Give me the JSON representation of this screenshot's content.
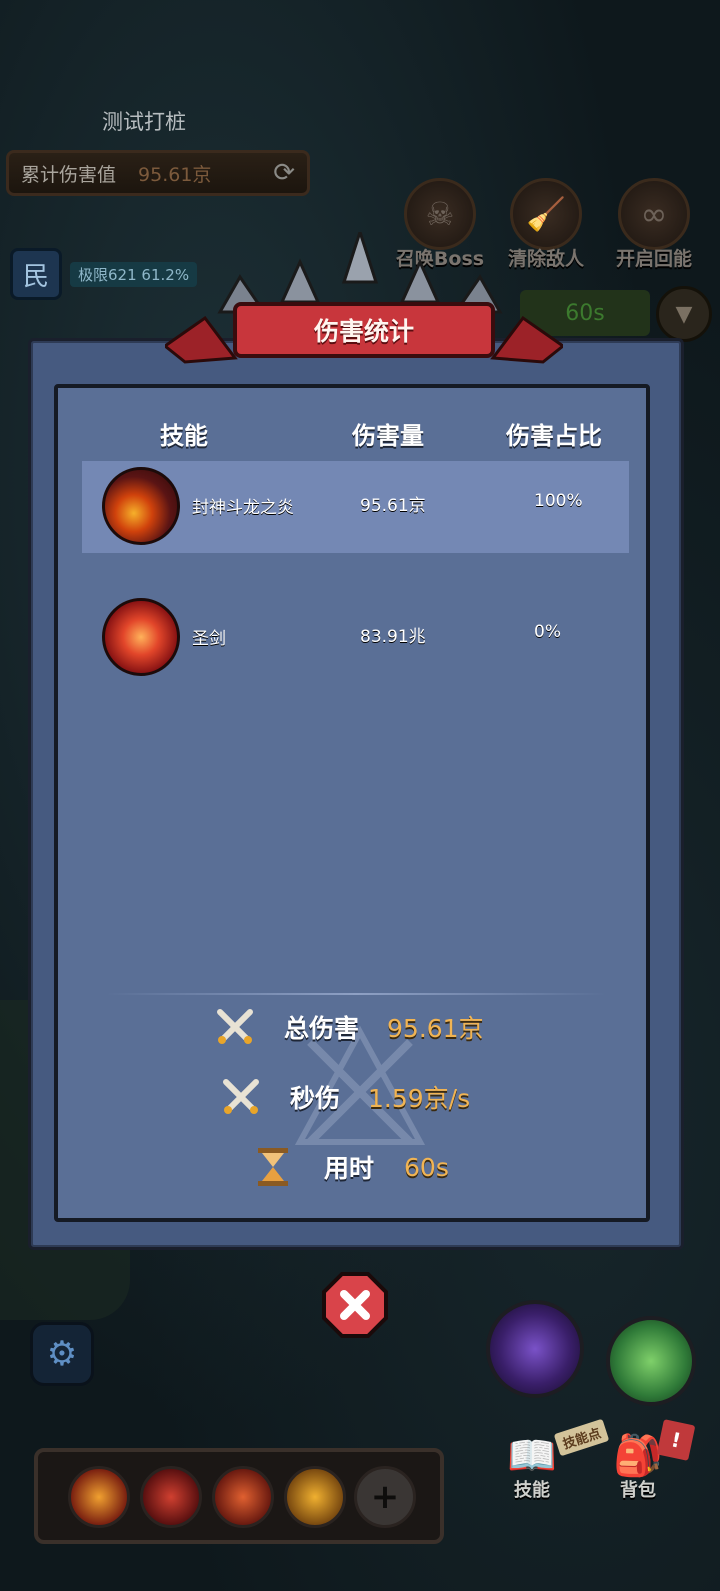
{
  "background": {
    "title": "测试打桩",
    "cumulative_damage": {
      "label": "累计伤害值",
      "value": "95.61京"
    },
    "limit": {
      "text": "极限621",
      "percent": "61.2%"
    },
    "top_buttons": [
      {
        "label": "召唤Boss",
        "icon": "skull-icon"
      },
      {
        "label": "清除敌人",
        "icon": "broom-icon"
      },
      {
        "label": "开启回能",
        "icon": "infinity-icon"
      }
    ],
    "timer": "60s"
  },
  "modal": {
    "title": "伤害统计",
    "columns": {
      "skill": "技能",
      "damage": "伤害量",
      "share": "伤害占比"
    },
    "rows": [
      {
        "name": "封神斗龙之炎",
        "damage": "95.61京",
        "share": "100%",
        "icon": "dragon-flame-icon",
        "selected": true
      },
      {
        "name": "圣剑",
        "damage": "83.91兆",
        "share": "0%",
        "icon": "holy-sword-icon",
        "selected": false
      }
    ],
    "summary": {
      "total": {
        "label": "总伤害",
        "value": "95.61京",
        "icon": "crossed-swords-icon"
      },
      "dps": {
        "label": "秒伤",
        "value": "1.59京/s",
        "icon": "crossed-swords-icon"
      },
      "time": {
        "label": "用时",
        "value": "60s",
        "icon": "hourglass-icon"
      }
    }
  },
  "bottom": {
    "nav": [
      {
        "label": "技能",
        "icon": "skill-book-icon"
      },
      {
        "label": "背包",
        "icon": "backpack-icon"
      }
    ],
    "skill_point_tag": "技能点",
    "alert": "!"
  },
  "colors": {
    "modal_bg": "#5a6f96",
    "row_selected": "#7488b4",
    "value_gold": "#f1b453",
    "banner_red": "#c8363c"
  }
}
